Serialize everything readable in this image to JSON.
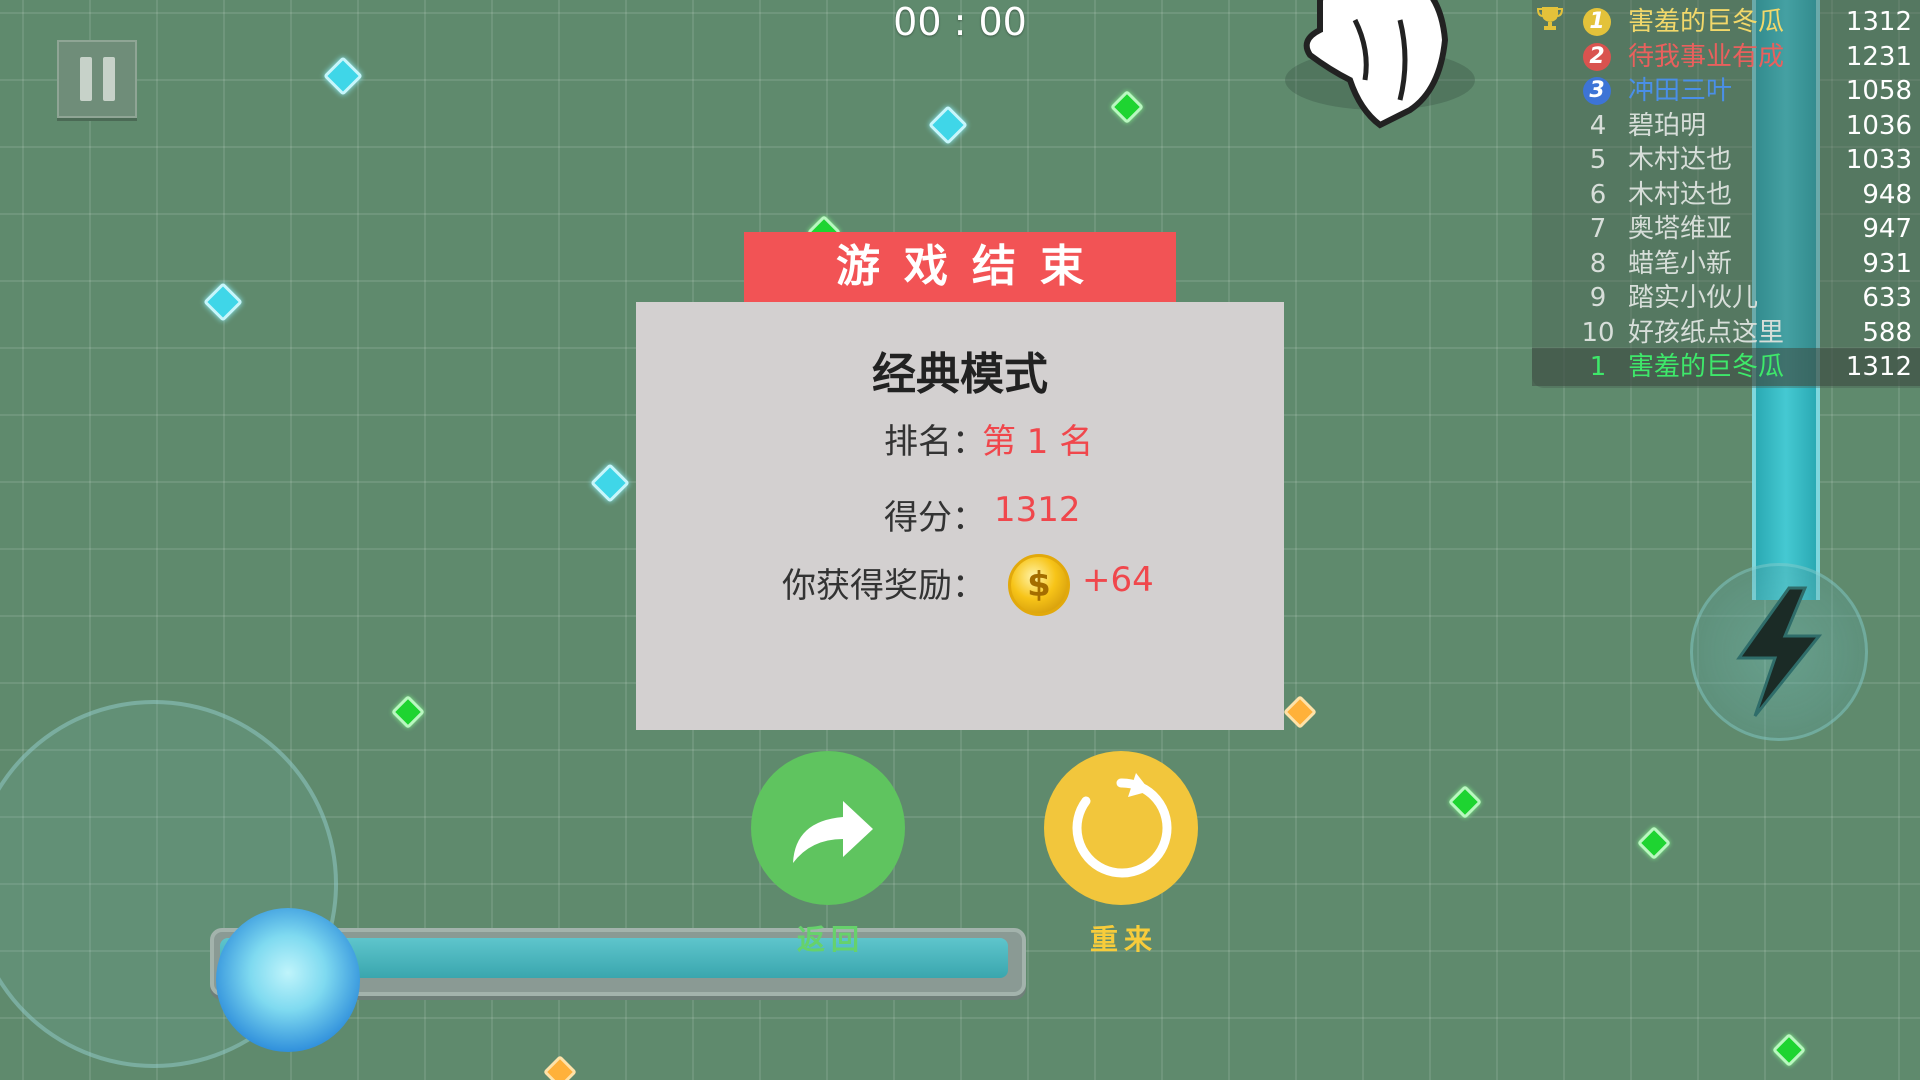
{
  "hud": {
    "timer": "00 : 00"
  },
  "leaderboard": {
    "rows": [
      {
        "rank": "1",
        "name": "害羞的巨冬瓜",
        "score": "1312",
        "color": "#f2d86a",
        "medal_color": "#e3c23a"
      },
      {
        "rank": "2",
        "name": "待我事业有成",
        "score": "1231",
        "color": "#e9605d",
        "medal_color": "#d9534f"
      },
      {
        "rank": "3",
        "name": "冲田三叶",
        "score": "1058",
        "color": "#4a8fe8",
        "medal_color": "#3d74d6"
      },
      {
        "rank": "4",
        "name": "碧珀明",
        "score": "1036"
      },
      {
        "rank": "5",
        "name": "木村达也",
        "score": "1033"
      },
      {
        "rank": "6",
        "name": "木村达也",
        "score": "948"
      },
      {
        "rank": "7",
        "name": "奥塔维亚",
        "score": "947"
      },
      {
        "rank": "8",
        "name": "蜡笔小新",
        "score": "931"
      },
      {
        "rank": "9",
        "name": "踏实小伙儿",
        "score": "633"
      },
      {
        "rank": "10",
        "name": "好孩纸点这里",
        "score": "588"
      }
    ],
    "self": {
      "rank": "1",
      "name": "害羞的巨冬瓜",
      "score": "1312",
      "color": "#3ee86a"
    }
  },
  "dialog": {
    "banner": "游戏结束",
    "mode": "经典模式",
    "rank_label": "排名：",
    "rank_value": "第 1 名",
    "score_label": "得分：",
    "score_value": "1312",
    "reward_label": "你获得奖励：",
    "reward_value": "+64",
    "coin_symbol": "$"
  },
  "buttons": {
    "back_label": "返回",
    "retry_label": "重来"
  },
  "energy": {
    "fill_fraction": 1.0
  },
  "colors": {
    "accent_red": "#f25355",
    "back_green": "#5fc45f",
    "retry_yellow": "#f2c63c"
  }
}
